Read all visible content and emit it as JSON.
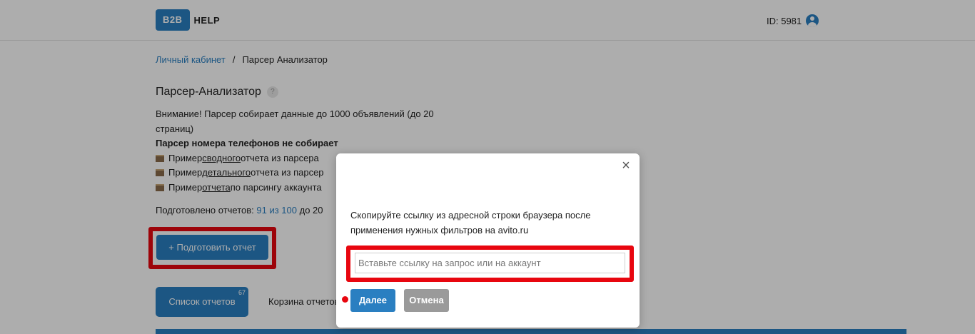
{
  "header": {
    "logo_left": "B2B",
    "logo_right": "HELP",
    "user_id": "ID: 5981"
  },
  "breadcrumb": {
    "home": "Личный кабинет",
    "separator": "/",
    "current": "Парсер Анализатор"
  },
  "page": {
    "title": "Парсер-Анализатор",
    "help_icon": "?",
    "warning_line1": "Внимание! Парсер собирает данные до 1000 объявлений (до 20",
    "warning_line2": "страниц)",
    "no_phones": "Парсер номера телефонов не собирает",
    "examples": [
      {
        "pre": "Пример ",
        "link": "сводного",
        "post": " отчета из парсера"
      },
      {
        "pre": "Пример ",
        "link": "детального",
        "post": " отчета из парсер"
      },
      {
        "pre": "Пример ",
        "link": "отчета",
        "post": " по парсингу аккаунта"
      }
    ],
    "prepared_label": "Подготовлено отчетов: ",
    "prepared_count": "91 из 100",
    "prepared_suffix": " до 20",
    "prepare_button": "+ Подготовить отчет"
  },
  "tabs": {
    "list_label": "Список отчетов",
    "list_badge": "67",
    "trash_label": "Корзина отчетов"
  },
  "modal": {
    "close": "×",
    "text_line1": "Скопируйте ссылку из адресной строки браузера после",
    "text_line2": "применения нужных фильтров на avito.ru",
    "input_placeholder": "Вставьте ссылку на запрос или на аккаунт",
    "next_button": "Далее",
    "cancel_button": "Отмена"
  },
  "colors": {
    "accent": "#2a7fc1",
    "highlight": "#e8060f"
  }
}
